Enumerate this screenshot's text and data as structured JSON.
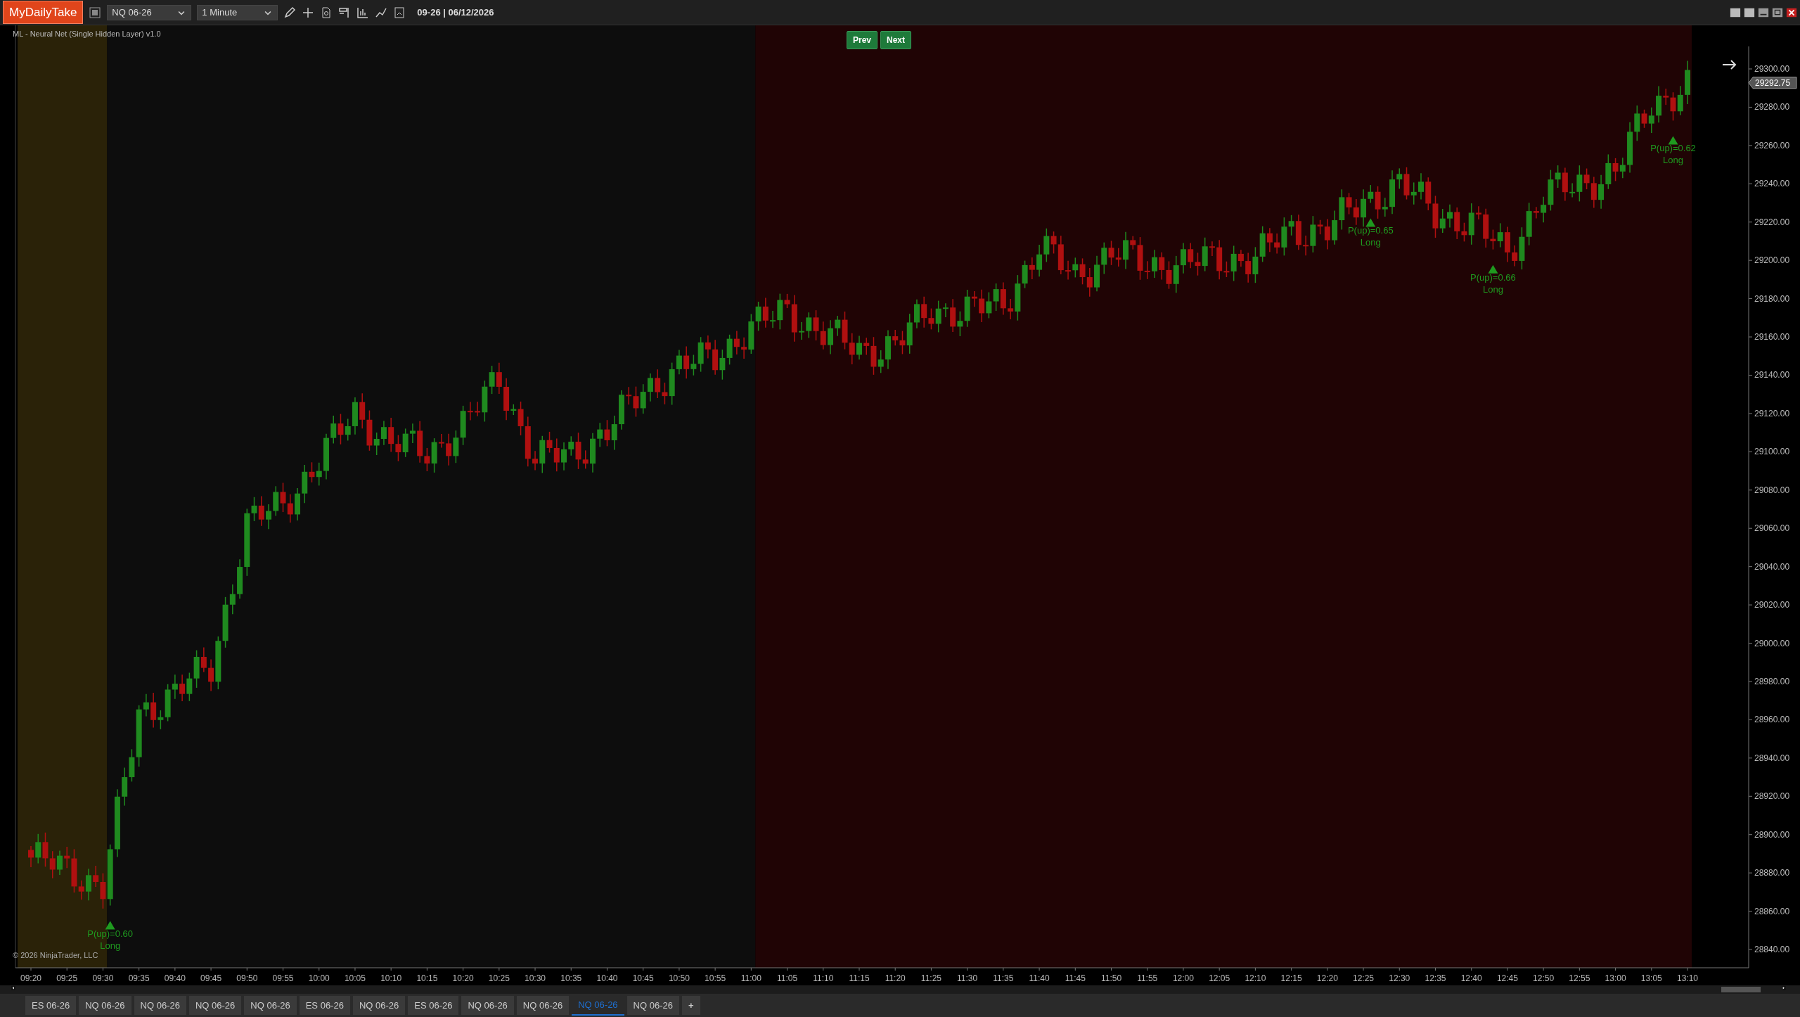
{
  "toolbar": {
    "logo": "MyDailyTake",
    "instrument": "NQ 06-26",
    "interval": "1 Minute",
    "info": "09-26 | 06/12/2026"
  },
  "chart": {
    "indicator_label": "ML - Neural Net (Single Hidden Layer) v1.0",
    "buttons": [
      "Prev",
      "Next"
    ],
    "copyright": "© 2026 NinjaTrader, LLC",
    "last_price": "29292.75",
    "sessions": [
      {
        "color": "#2a2208"
      },
      {
        "color": "#0d0d0d"
      },
      {
        "color": "#200405"
      }
    ],
    "signals": [
      {
        "text": "P(up)=0.60",
        "action": "Long"
      },
      {
        "text": "P(up)=0.65",
        "action": "Long"
      },
      {
        "text": "P(up)=0.66",
        "action": "Long"
      },
      {
        "text": "P(up)=0.62",
        "action": "Long"
      }
    ],
    "time_axis": [
      "09:20",
      "09:25",
      "09:30",
      "09:35",
      "09:40",
      "09:45",
      "09:50",
      "09:55",
      "10:00",
      "10:05",
      "10:10",
      "10:15",
      "10:20",
      "10:25",
      "10:30",
      "10:35",
      "10:40",
      "10:45",
      "10:50",
      "10:55",
      "11:00",
      "11:05",
      "11:10",
      "11:15",
      "11:20",
      "11:25",
      "11:30",
      "11:35",
      "11:40",
      "11:45",
      "11:50",
      "11:55",
      "12:00",
      "12:05",
      "12:10",
      "12:15",
      "12:20",
      "12:25",
      "12:30",
      "12:35",
      "12:40",
      "12:45",
      "12:50",
      "12:55",
      "13:00",
      "13:05",
      "13:10"
    ],
    "price_axis": [
      "29300.00",
      "29280.00",
      "29260.00",
      "29240.00",
      "29220.00",
      "29200.00",
      "29180.00",
      "29160.00",
      "29140.00",
      "29120.00",
      "29100.00",
      "29080.00",
      "29060.00",
      "29040.00",
      "29020.00",
      "29000.00",
      "28980.00",
      "28960.00",
      "28940.00",
      "28920.00",
      "28900.00",
      "28880.00",
      "28860.00",
      "28840.00"
    ]
  },
  "tabs": [
    {
      "label": "ES 06-26",
      "selected": false
    },
    {
      "label": "NQ 06-26",
      "selected": false
    },
    {
      "label": "NQ 06-26",
      "selected": false
    },
    {
      "label": "NQ 06-26",
      "selected": false
    },
    {
      "label": "NQ 06-26",
      "selected": false
    },
    {
      "label": "ES 06-26",
      "selected": false
    },
    {
      "label": "NQ 06-26",
      "selected": false
    },
    {
      "label": "ES 06-26",
      "selected": false
    },
    {
      "label": "NQ 06-26",
      "selected": false
    },
    {
      "label": "NQ 06-26",
      "selected": false
    },
    {
      "label": "NQ 06-26",
      "selected": true
    },
    {
      "label": "NQ 06-26",
      "selected": false
    }
  ],
  "add_tab": "+"
}
